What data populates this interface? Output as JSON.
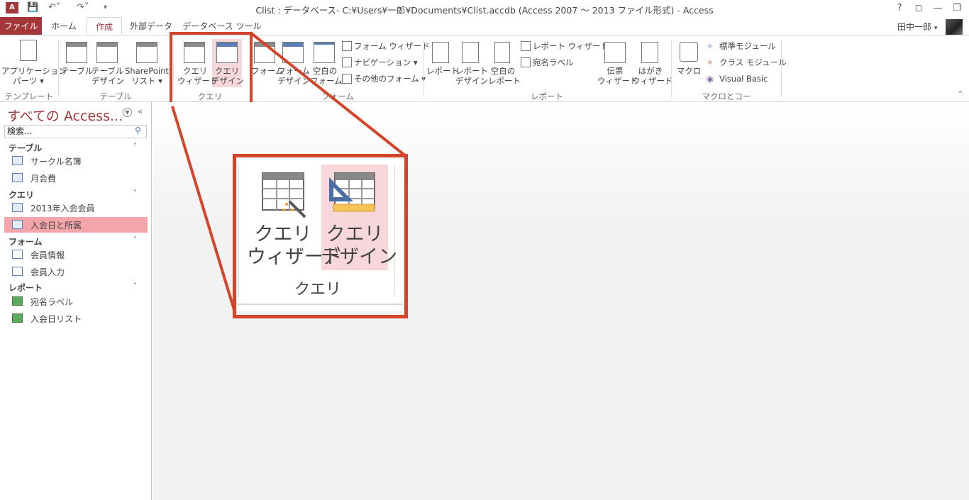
{
  "window": {
    "title": "Clist : データベース- C:¥Users¥一郎¥Documents¥Clist.accdb (Access 2007 ～ 2013 ファイル形式) - Access",
    "app_icon": "A",
    "help": "?",
    "user": "田中一郎"
  },
  "tabs": [
    "ファイル",
    "ホーム",
    "作成",
    "外部データ",
    "データベース ツール"
  ],
  "ribbon": {
    "groups": {
      "template": "テンプレート",
      "table": "テーブル",
      "query": "クエリ",
      "form": "フォーム",
      "report": "レポート",
      "macro": "マクロとコード"
    },
    "app_parts": [
      "アプリケーション",
      "パーツ ▾"
    ],
    "table": [
      "テーブル"
    ],
    "table_design": [
      "テーブル",
      "デザイン"
    ],
    "sharepoint": [
      "SharePoint",
      "リスト ▾"
    ],
    "query_wizard": [
      "クエリ",
      "ウィザード"
    ],
    "query_design": [
      "クエリ",
      "デザイン"
    ],
    "form": [
      "フォーム"
    ],
    "form_design": [
      "フォーム",
      "デザイン"
    ],
    "blank_form": [
      "空白の",
      "フォーム"
    ],
    "form_wizard": "フォーム ウィザード",
    "navigation": "ナビゲーション ▾",
    "more_forms": "その他のフォーム ▾",
    "report": [
      "レポート"
    ],
    "report_design": [
      "レポート",
      "デザイン"
    ],
    "blank_report": [
      "空白の",
      "レポート"
    ],
    "report_wizard": "レポート ウィザード",
    "labels": "宛名ラベル",
    "slip_wizard": [
      "伝票",
      "ウィザード"
    ],
    "postcard_wizard": [
      "はがき",
      "ウィザード"
    ],
    "macro": [
      "マクロ"
    ],
    "module": "標準モジュール",
    "class_module": "クラス モジュール",
    "vba": "Visual Basic"
  },
  "nav": {
    "title": "すべての Access...",
    "search_value": "検索...",
    "groups": [
      {
        "label": "テーブル",
        "items": [
          "サークル名簿",
          "月会費"
        ]
      },
      {
        "label": "クエリ",
        "items": [
          "2013年入会会員",
          "入会日と所属"
        ]
      },
      {
        "label": "フォーム",
        "items": [
          "会員情報",
          "会員入力"
        ]
      },
      {
        "label": "レポート",
        "items": [
          "宛名ラベル",
          "入会日リスト"
        ]
      }
    ]
  },
  "zoom": {
    "wizard": [
      "クエリ",
      "ウィザード"
    ],
    "design": [
      "クエリ",
      "デザイン"
    ],
    "group": "クエリ"
  },
  "colors": {
    "accent": "#a4373a",
    "highlight": "#f7d7d9",
    "callout": "#d2452a",
    "selected_item": "#f4a5aa"
  }
}
